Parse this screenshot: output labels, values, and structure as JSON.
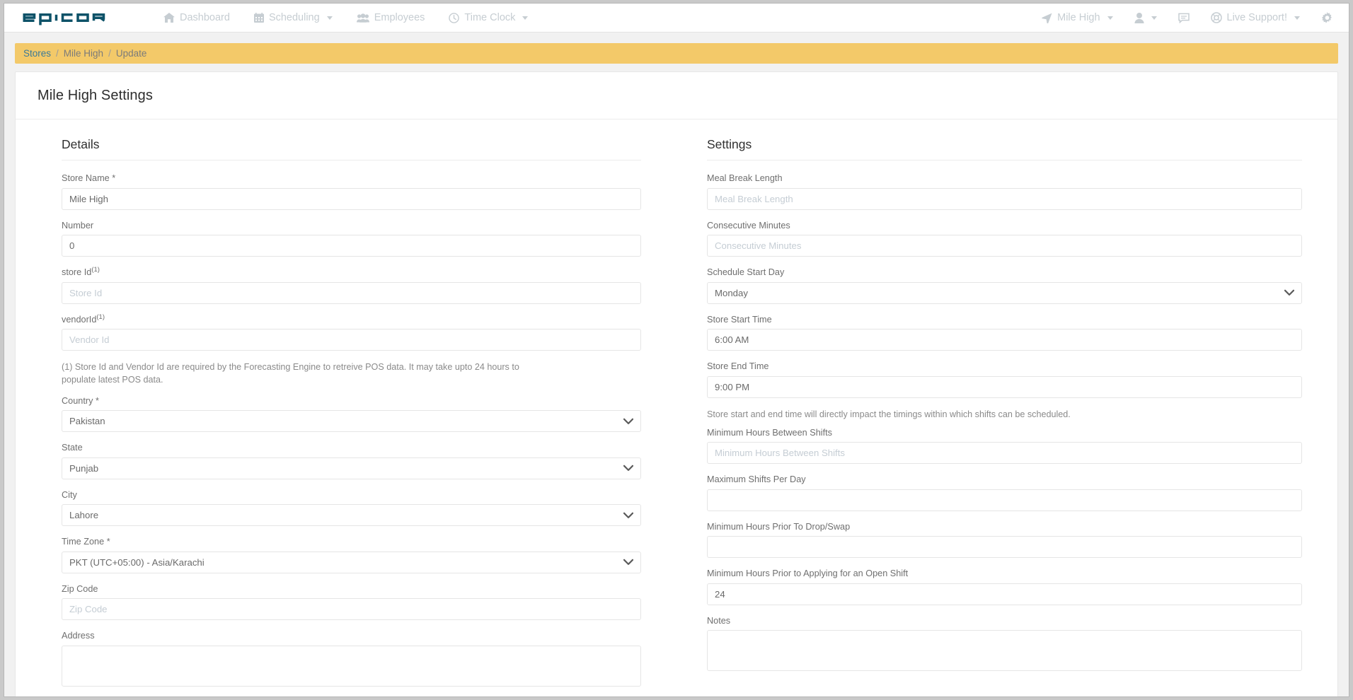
{
  "navbar": {
    "brand": "EPICOR",
    "left_items": [
      {
        "label": "Dashboard",
        "icon": "home-icon",
        "caret": false
      },
      {
        "label": "Scheduling",
        "icon": "calendar-icon",
        "caret": true
      },
      {
        "label": "Employees",
        "icon": "users-icon",
        "caret": false
      },
      {
        "label": "Time Clock",
        "icon": "clock-icon",
        "caret": true
      }
    ],
    "right_items": [
      {
        "label": "Mile High",
        "icon": "location-arrow-icon",
        "caret": true
      },
      {
        "label": "",
        "icon": "user-icon",
        "caret": true
      },
      {
        "label": "",
        "icon": "comment-icon",
        "caret": false
      },
      {
        "label": "Live Support!",
        "icon": "lifering-icon",
        "caret": true
      },
      {
        "label": "",
        "icon": "gear-icon",
        "caret": false
      }
    ]
  },
  "breadcrumb": {
    "items": [
      "Stores",
      "Mile High",
      "Update"
    ],
    "separator": "/",
    "background": "#f3c969",
    "link_color": "#3b7a99"
  },
  "page": {
    "title": "Mile High Settings"
  },
  "details": {
    "heading": "Details",
    "store_name": {
      "label": "Store Name *",
      "value": "Mile High",
      "placeholder": "Store Name"
    },
    "number": {
      "label": "Number",
      "value": "0",
      "placeholder": "Number"
    },
    "store_id": {
      "label": "store Id",
      "sup": "(1)",
      "value": "",
      "placeholder": "Store Id"
    },
    "vendor_id": {
      "label": "vendorId",
      "sup": "(1)",
      "value": "",
      "placeholder": "Vendor Id"
    },
    "footnote": "(1) Store Id and Vendor Id are required by the Forecasting Engine to retreive POS data. It may take upto 24 hours to populate latest POS data.",
    "country": {
      "label": "Country *",
      "value": "Pakistan",
      "options": [
        "Pakistan"
      ]
    },
    "state": {
      "label": "State",
      "value": "Punjab",
      "options": [
        "Punjab"
      ]
    },
    "city": {
      "label": "City",
      "value": "Lahore",
      "options": [
        "Lahore"
      ]
    },
    "time_zone": {
      "label": "Time Zone *",
      "value": "PKT (UTC+05:00) - Asia/Karachi",
      "options": [
        "PKT (UTC+05:00) - Asia/Karachi"
      ]
    },
    "zip_code": {
      "label": "Zip Code",
      "value": "",
      "placeholder": "Zip Code"
    },
    "address": {
      "label": "Address",
      "value": "",
      "placeholder": ""
    }
  },
  "settings": {
    "heading": "Settings",
    "meal_break_length": {
      "label": "Meal Break Length",
      "value": "",
      "placeholder": "Meal Break Length"
    },
    "consecutive_minutes": {
      "label": "Consecutive Minutes",
      "value": "",
      "placeholder": "Consecutive Minutes"
    },
    "schedule_start_day": {
      "label": "Schedule Start Day",
      "value": "Monday",
      "options": [
        "Monday"
      ]
    },
    "store_start_time": {
      "label": "Store Start Time",
      "value": "6:00 AM",
      "placeholder": "Store Start Time"
    },
    "store_end_time": {
      "label": "Store End Time",
      "value": "9:00 PM",
      "placeholder": "Store End Time"
    },
    "store_time_hint": "Store start and end time will directly impact the timings within which shifts can be scheduled.",
    "min_hours_between_shifts": {
      "label": "Minimum Hours Between Shifts",
      "value": "",
      "placeholder": "Minimum Hours Between Shifts"
    },
    "max_shifts_per_day": {
      "label": "Maximum Shifts Per Day",
      "value": "",
      "placeholder": ""
    },
    "min_hours_prior_drop_swap": {
      "label": "Minimum Hours Prior To Drop/Swap",
      "value": "",
      "placeholder": ""
    },
    "min_hours_prior_open_shift": {
      "label": "Minimum Hours Prior to Applying for an Open Shift",
      "value": "24",
      "placeholder": ""
    },
    "notes": {
      "label": "Notes",
      "value": "",
      "placeholder": ""
    }
  }
}
